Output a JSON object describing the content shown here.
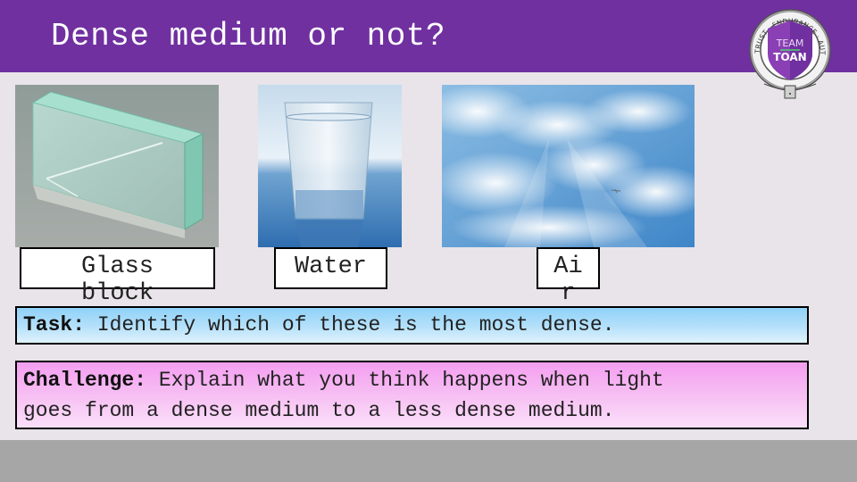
{
  "slide": {
    "title": "Dense medium or not?",
    "header_color": "#7030A0",
    "background_color": "#E8E4E9",
    "footer_color": "#A5A6A5"
  },
  "logo": {
    "icon": "team-toan-badge-icon",
    "line1": "TEAM",
    "line2": "TOAN",
    "ring_text": "TRUST · ENDURANCE · AUTONOMY · MASTERY"
  },
  "images": [
    {
      "name": "glass-block-image",
      "label": "Glass block",
      "depicts": "rectangular glass block"
    },
    {
      "name": "water-glass-image",
      "label": "Water",
      "depicts": "glass of water"
    },
    {
      "name": "sky-clouds-image",
      "label": "Air",
      "depicts": "sky with clouds and airplane"
    }
  ],
  "labels": {
    "glass_line1": "Glass",
    "glass_line2": "block",
    "water": "Water",
    "air_line1": "Ai",
    "air_line2": "r"
  },
  "task": {
    "prefix": "Task:",
    "text": " Identify which of these is the most dense.",
    "color": "#8FD1F8"
  },
  "challenge": {
    "prefix": "Challenge:",
    "line1": " Explain what you think happens when light",
    "line2": "goes from a dense medium to a less dense medium.",
    "color": "#F49EF0"
  }
}
